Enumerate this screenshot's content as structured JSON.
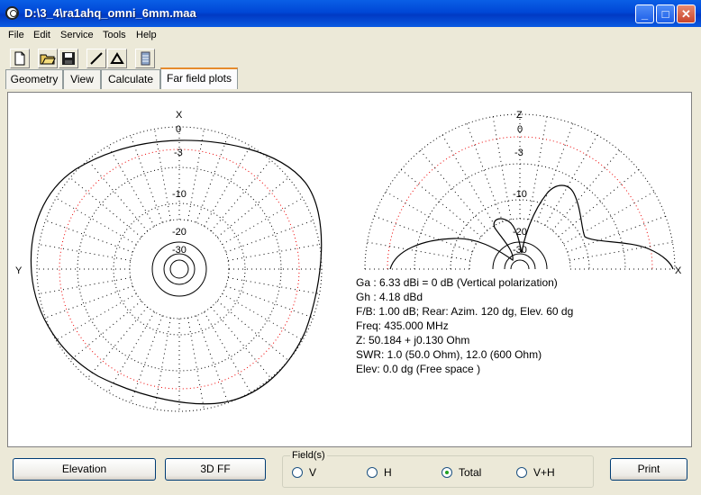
{
  "window": {
    "title": "D:\\3_4\\ra1ahq_omni_6mm.maa",
    "minimize": "_",
    "maximize": "□",
    "close": "✕"
  },
  "menu": [
    "File",
    "Edit",
    "Service",
    "Tools",
    "Help"
  ],
  "toolbar": [
    "new-file-icon",
    "open-folder-icon",
    "save-disk-icon",
    "draw-line-icon",
    "triangle-icon",
    "database-icon"
  ],
  "tabs": [
    "Geometry",
    "View",
    "Calculate",
    "Far field plots"
  ],
  "left_plot": {
    "axis_top": "X",
    "axis_left": "Y",
    "rings": [
      "0",
      "-3",
      "-10",
      "-20",
      "-30"
    ]
  },
  "right_plot": {
    "axis_top": "Z",
    "axis_right": "X",
    "rings": [
      "0",
      "-3",
      "-10",
      "-20",
      "-30"
    ]
  },
  "info": [
    "Ga : 6.33 dBi = 0 dB  (Vertical polarization)",
    "Gh : 4.18 dBd",
    "F/B: 1.00 dB; Rear: Azim. 120 dg,  Elev. 60 dg",
    "Freq: 435.000 MHz",
    "Z: 50.184 + j0.130 Ohm",
    "SWR: 1.0 (50.0 Ohm), 12.0 (600 Ohm)",
    "Elev: 0.0 dg (Free space  )"
  ],
  "bottom": {
    "elevation": "Elevation",
    "ff3d": "3D FF",
    "fields_legend": "Field(s)",
    "radios": [
      {
        "label": "V",
        "selected": false
      },
      {
        "label": "H",
        "selected": false
      },
      {
        "label": "Total",
        "selected": true
      },
      {
        "label": "V+H",
        "selected": false
      }
    ],
    "print": "Print"
  }
}
